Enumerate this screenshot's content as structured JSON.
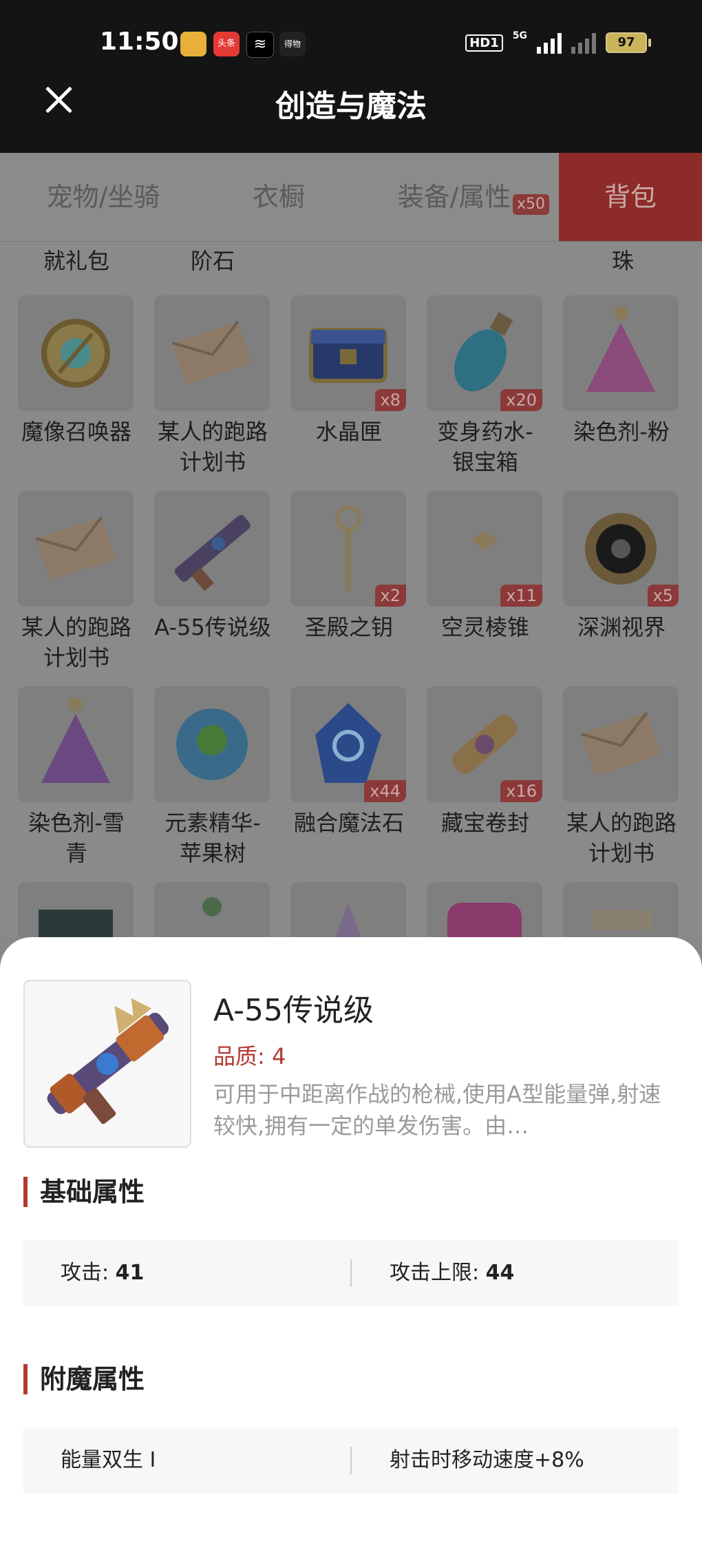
{
  "status_bar": {
    "time": "11:50",
    "apps": [
      "微博",
      "头条",
      "剪映",
      "得物"
    ],
    "hd": "HD1",
    "network": "5G",
    "battery": "97"
  },
  "header": {
    "title": "创造与魔法"
  },
  "tabs": [
    {
      "label": "宠物/坐骑"
    },
    {
      "label": "衣橱"
    },
    {
      "label": "装备/属性",
      "badge": "x50"
    },
    {
      "label": "背包",
      "active": true
    }
  ],
  "grid": {
    "partial_row": [
      "就礼包",
      "阶石",
      "",
      "",
      "珠"
    ],
    "rows": [
      [
        {
          "name": "魔像召唤器",
          "name2": "",
          "qty": "",
          "icon": "golem-summoner-icon"
        },
        {
          "name": "某人的跑路",
          "name2": "计划书",
          "qty": "",
          "icon": "envelope-icon"
        },
        {
          "name": "水晶匣",
          "name2": "",
          "qty": "x8",
          "icon": "crystal-chest-icon"
        },
        {
          "name": "变身药水-",
          "name2": "银宝箱",
          "qty": "x20",
          "icon": "potion-bottle-icon"
        },
        {
          "name": "染色剂-粉",
          "name2": "",
          "qty": "",
          "icon": "pink-dye-icon"
        }
      ],
      [
        {
          "name": "某人的跑路",
          "name2": "计划书",
          "qty": "",
          "icon": "envelope-icon"
        },
        {
          "name": "A-55传说级",
          "name2": "",
          "qty": "",
          "icon": "gun-icon"
        },
        {
          "name": "圣殿之钥",
          "name2": "",
          "qty": "x2",
          "icon": "key-icon"
        },
        {
          "name": "空灵棱锥",
          "name2": "",
          "qty": "x11",
          "icon": "pyramid-icon"
        },
        {
          "name": "深渊视界",
          "name2": "",
          "qty": "x5",
          "icon": "abyss-vision-icon"
        }
      ],
      [
        {
          "name": "染色剂-雪",
          "name2": "青",
          "qty": "",
          "icon": "purple-dye-icon"
        },
        {
          "name": "元素精华-",
          "name2": "苹果树",
          "qty": "",
          "icon": "element-orb-icon"
        },
        {
          "name": "融合魔法石",
          "name2": "",
          "qty": "x44",
          "icon": "magic-stone-icon"
        },
        {
          "name": "藏宝卷封",
          "name2": "",
          "qty": "x16",
          "icon": "treasure-scroll-icon"
        },
        {
          "name": "某人的跑路",
          "name2": "计划书",
          "qty": "",
          "icon": "envelope-icon"
        }
      ]
    ]
  },
  "detail": {
    "title": "A-55传说级",
    "quality_label": "品质:",
    "quality_value": "4",
    "description": "可用于中距离作战的枪械,使用A型能量弹,射速较快,拥有一定的单发伤害。由…",
    "base_section": "基础属性",
    "base_attrs": [
      {
        "label": "攻击:",
        "value": "41"
      },
      {
        "label": "攻击上限:",
        "value": "44"
      }
    ],
    "enchant_section": "附魔属性",
    "enchant_attrs": [
      "能量双生 I",
      "射击时移动速度+8%"
    ]
  }
}
